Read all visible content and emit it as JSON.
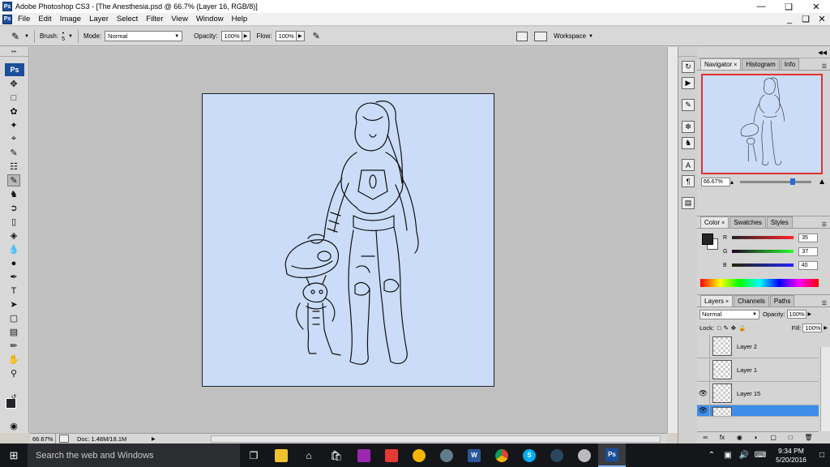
{
  "window": {
    "title": "Adobe Photoshop CS3 - [The Anesthesia.psd @ 66.7% (Layer 16, RGB/8)]",
    "app_badge": "Ps"
  },
  "menu": {
    "items": [
      "File",
      "Edit",
      "Image",
      "Layer",
      "Select",
      "Filter",
      "View",
      "Window",
      "Help"
    ]
  },
  "options": {
    "brush_label": "Brush:",
    "brush_size": "5",
    "mode_label": "Mode:",
    "mode_value": "Normal",
    "opacity_label": "Opacity:",
    "opacity_value": "100%",
    "flow_label": "Flow:",
    "flow_value": "100%",
    "workspace_label": "Workspace"
  },
  "status": {
    "zoom": "66.67%",
    "doc": "Doc: 1.48M/18.1M"
  },
  "navigator": {
    "tabs": [
      "Navigator",
      "Histogram",
      "Info"
    ],
    "zoom": "66.67%"
  },
  "color_panel": {
    "tabs": [
      "Color",
      "Swatches",
      "Styles"
    ],
    "r_label": "R",
    "g_label": "G",
    "b_label": "B",
    "r": "35",
    "g": "37",
    "b": "40",
    "fg_color": "#232528"
  },
  "layers_panel": {
    "tabs": [
      "Layers",
      "Channels",
      "Paths"
    ],
    "blend_mode": "Normal",
    "opacity_label": "Opacity:",
    "opacity": "100%",
    "lock_label": "Lock:",
    "fill_label": "Fill:",
    "fill": "100%",
    "layers": [
      {
        "name": "Layer 2",
        "visible": false
      },
      {
        "name": "Layer 1",
        "visible": false
      },
      {
        "name": "Layer 15",
        "visible": true
      },
      {
        "name": "",
        "visible": true,
        "active": true
      }
    ]
  },
  "taskbar": {
    "search_placeholder": "Search the web and Windows",
    "time": "9:34 PM",
    "date": "5/20/2016",
    "app_labels": [
      "W",
      "Ps"
    ]
  },
  "colors": {
    "canvas_bg": "#cbdcf8",
    "accent_selection": "#3d8ee8",
    "navigator_frame": "#dd3333",
    "ps_blue": "#1a4f9b"
  }
}
